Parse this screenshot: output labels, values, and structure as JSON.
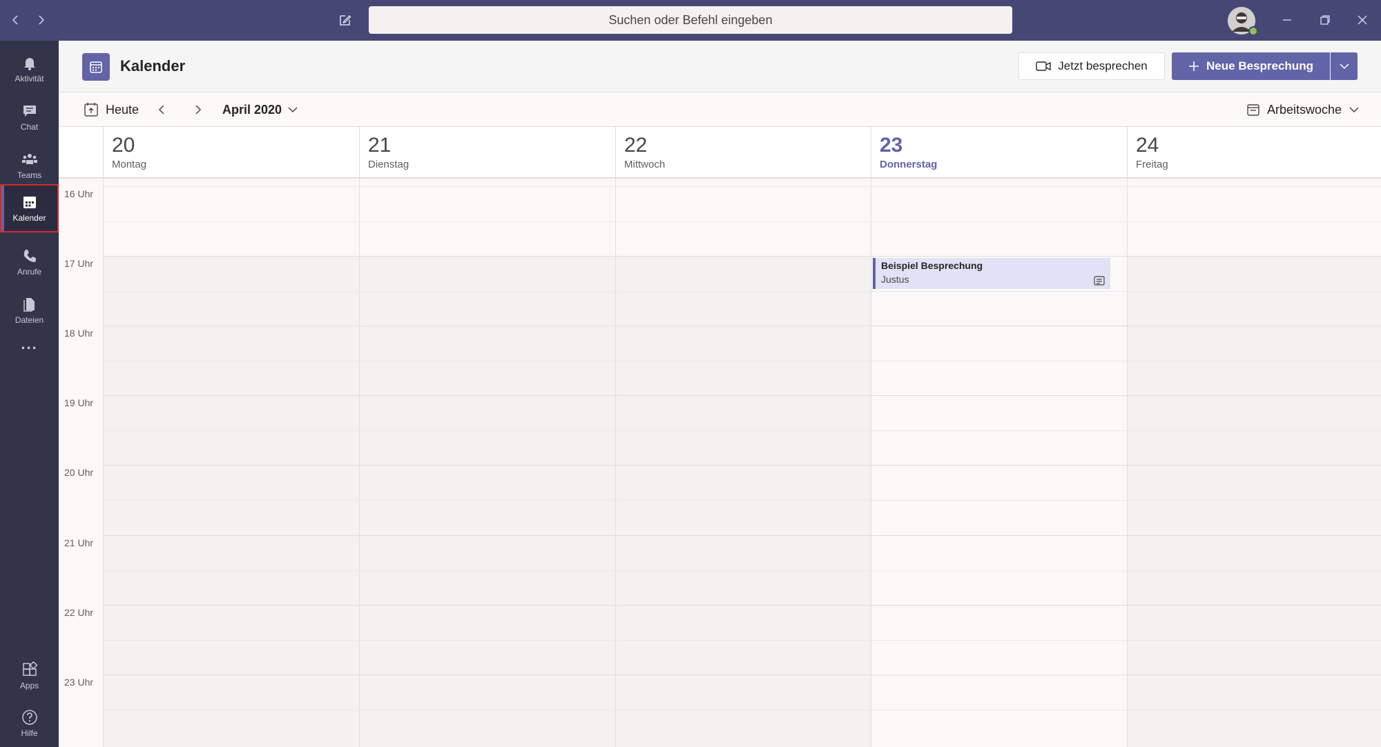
{
  "titlebar": {
    "search_placeholder": "Suchen oder Befehl eingeben"
  },
  "rail": {
    "items": [
      {
        "label": "Aktivität",
        "icon": "bell-icon"
      },
      {
        "label": "Chat",
        "icon": "chat-icon"
      },
      {
        "label": "Teams",
        "icon": "teams-icon"
      },
      {
        "label": "Kalender",
        "icon": "calendar-icon",
        "active": true
      },
      {
        "label": "Anrufe",
        "icon": "phone-icon"
      },
      {
        "label": "Dateien",
        "icon": "file-icon"
      }
    ],
    "more": "...",
    "apps_label": "Apps",
    "help_label": "Hilfe"
  },
  "header": {
    "title": "Kalender",
    "meet_now_label": "Jetzt besprechen",
    "new_meeting_label": "Neue Besprechung"
  },
  "toolbar": {
    "today_label": "Heute",
    "month_label": "April 2020",
    "view_label": "Arbeitswoche"
  },
  "days": [
    {
      "num": "20",
      "name": "Montag"
    },
    {
      "num": "21",
      "name": "Dienstag"
    },
    {
      "num": "22",
      "name": "Mittwoch"
    },
    {
      "num": "23",
      "name": "Donnerstag",
      "today": true
    },
    {
      "num": "24",
      "name": "Freitag"
    }
  ],
  "hours": [
    "16 Uhr",
    "17 Uhr",
    "18 Uhr",
    "19 Uhr",
    "20 Uhr",
    "21 Uhr",
    "22 Uhr",
    "23 Uhr"
  ],
  "event": {
    "title": "Beispiel Besprechung",
    "organizer": "Justus",
    "day": "23",
    "start": "17 Uhr"
  },
  "colors": {
    "brand": "#6264a7",
    "titlebar": "#464775",
    "rail": "#33344a",
    "event_bg": "#e2e2f6",
    "status_available": "#92c353"
  }
}
